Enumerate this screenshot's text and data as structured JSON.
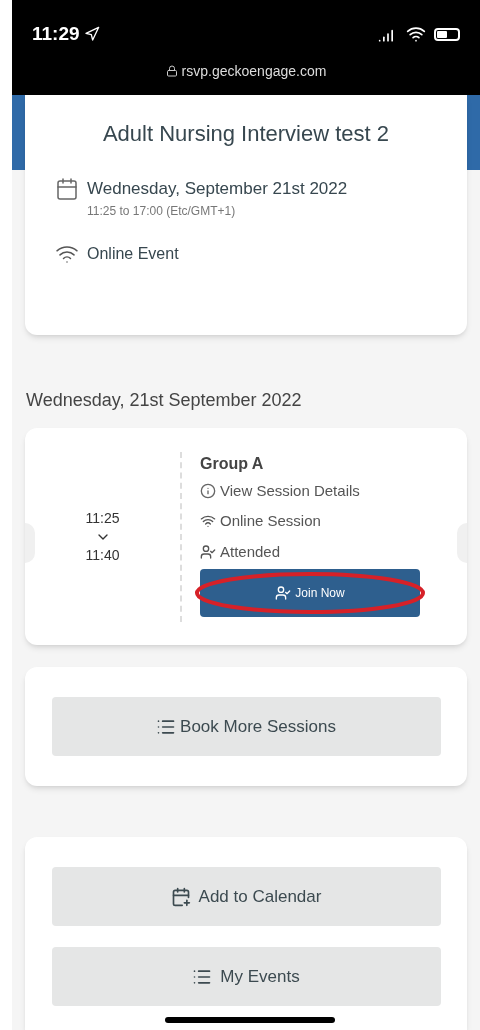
{
  "status_bar": {
    "time": "11:29",
    "url": "rsvp.geckoengage.com"
  },
  "event": {
    "title": "Adult Nursing Interview test 2",
    "date": "Wednesday, September 21st 2022",
    "time_range": "11:25 to 17:00 (Etc/GMT+1)",
    "location": "Online Event"
  },
  "section_date": "Wednesday, 21st September 2022",
  "session": {
    "start": "11:25",
    "end": "11:40",
    "name": "Group A",
    "details_link": "View Session Details",
    "location": "Online Session",
    "status": "Attended",
    "join_button": "Join Now",
    "highlighted": true
  },
  "book_button": "Book More Sessions",
  "actions": [
    {
      "kind": "calendar",
      "label": "Add to Calendar"
    },
    {
      "kind": "list",
      "label": "My Events"
    }
  ]
}
